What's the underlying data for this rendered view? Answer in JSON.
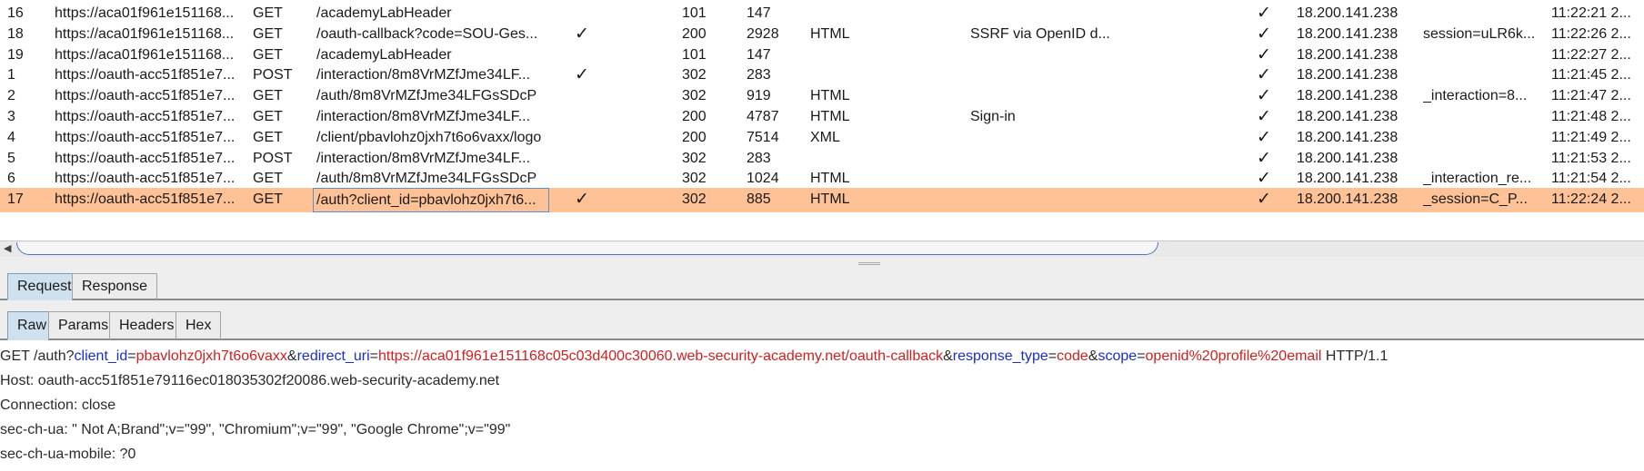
{
  "history": {
    "rows": [
      {
        "num": "16",
        "host": "https://aca01f961e151168...",
        "method": "GET",
        "url": "/academyLabHeader",
        "params": "",
        "status": "101",
        "length": "147",
        "mime": "",
        "title": "",
        "tls": "✓",
        "ip": "18.200.141.238",
        "cookies": "",
        "time": "11:22:21 2..."
      },
      {
        "num": "18",
        "host": "https://aca01f961e151168...",
        "method": "GET",
        "url": "/oauth-callback?code=SOU-Ges...",
        "params": "✓",
        "status": "200",
        "length": "2928",
        "mime": "HTML",
        "title": "SSRF via OpenID d...",
        "tls": "✓",
        "ip": "18.200.141.238",
        "cookies": "session=uLR6k...",
        "time": "11:22:26 2..."
      },
      {
        "num": "19",
        "host": "https://aca01f961e151168...",
        "method": "GET",
        "url": "/academyLabHeader",
        "params": "",
        "status": "101",
        "length": "147",
        "mime": "",
        "title": "",
        "tls": "✓",
        "ip": "18.200.141.238",
        "cookies": "",
        "time": "11:22:27 2..."
      },
      {
        "num": "1",
        "host": "https://oauth-acc51f851e7...",
        "method": "POST",
        "url": "/interaction/8m8VrMZfJme34LF...",
        "params": "✓",
        "status": "302",
        "length": "283",
        "mime": "",
        "title": "",
        "tls": "✓",
        "ip": "18.200.141.238",
        "cookies": "",
        "time": "11:21:45 2..."
      },
      {
        "num": "2",
        "host": "https://oauth-acc51f851e7...",
        "method": "GET",
        "url": "/auth/8m8VrMZfJme34LFGsSDcP",
        "params": "",
        "status": "302",
        "length": "919",
        "mime": "HTML",
        "title": "",
        "tls": "✓",
        "ip": "18.200.141.238",
        "cookies": "_interaction=8...",
        "time": "11:21:47 2..."
      },
      {
        "num": "3",
        "host": "https://oauth-acc51f851e7...",
        "method": "GET",
        "url": "/interaction/8m8VrMZfJme34LF...",
        "params": "",
        "status": "200",
        "length": "4787",
        "mime": "HTML",
        "title": "Sign-in",
        "tls": "✓",
        "ip": "18.200.141.238",
        "cookies": "",
        "time": "11:21:48 2..."
      },
      {
        "num": "4",
        "host": "https://oauth-acc51f851e7...",
        "method": "GET",
        "url": "/client/pbavlohz0jxh7t6o6vaxx/logo",
        "params": "",
        "status": "200",
        "length": "7514",
        "mime": "XML",
        "title": "",
        "tls": "✓",
        "ip": "18.200.141.238",
        "cookies": "",
        "time": "11:21:49 2..."
      },
      {
        "num": "5",
        "host": "https://oauth-acc51f851e7...",
        "method": "POST",
        "url": "/interaction/8m8VrMZfJme34LF...",
        "params": "",
        "status": "302",
        "length": "283",
        "mime": "",
        "title": "",
        "tls": "✓",
        "ip": "18.200.141.238",
        "cookies": "",
        "time": "11:21:53 2..."
      },
      {
        "num": "6",
        "host": "https://oauth-acc51f851e7...",
        "method": "GET",
        "url": "/auth/8m8VrMZfJme34LFGsSDcP",
        "params": "",
        "status": "302",
        "length": "1024",
        "mime": "HTML",
        "title": "",
        "tls": "✓",
        "ip": "18.200.141.238",
        "cookies": "_interaction_re...",
        "time": "11:21:54 2..."
      },
      {
        "num": "17",
        "host": "https://oauth-acc51f851e7...",
        "method": "GET",
        "url": "/auth?client_id=pbavlohz0jxh7t6...",
        "params": "✓",
        "status": "302",
        "length": "885",
        "mime": "HTML",
        "title": "",
        "tls": "✓",
        "ip": "18.200.141.238",
        "cookies": "_session=C_P...",
        "time": "11:22:24 2...",
        "selected": true
      }
    ]
  },
  "scroll_arrow": "◀",
  "outer_tabs": {
    "request": "Request",
    "response": "Response"
  },
  "inner_tabs": {
    "raw": "Raw",
    "params": "Params",
    "headers": "Headers",
    "hex": "Hex"
  },
  "request": {
    "req_prefix": "GET /auth?",
    "params": [
      {
        "name": "client_id",
        "value": "pbavlohz0jxh7t6o6vaxx"
      },
      {
        "name": "redirect_uri",
        "value": "https://aca01f961e151168c05c03d400c30060.web-security-academy.net/oauth-callback"
      },
      {
        "name": "response_type",
        "value": "code"
      },
      {
        "name": "scope",
        "value": "openid%20profile%20email"
      }
    ],
    "req_suffix": " HTTP/1.1",
    "host_line": "Host: oauth-acc51f851e79116ec018035302f20086.web-security-academy.net",
    "connection_line": "Connection: close",
    "sec_ch_ua_line": "sec-ch-ua: \" Not A;Brand\";v=\"99\", \"Chromium\";v=\"99\", \"Google Chrome\";v=\"99\"",
    "sec_ch_ua_mobile_line": "sec-ch-ua-mobile: ?0"
  },
  "colors": {
    "selected_row": "#ffc296",
    "param_name": "#1a2ecc",
    "param_value": "#d21e1e",
    "active_tab": "#cfe1ee"
  }
}
